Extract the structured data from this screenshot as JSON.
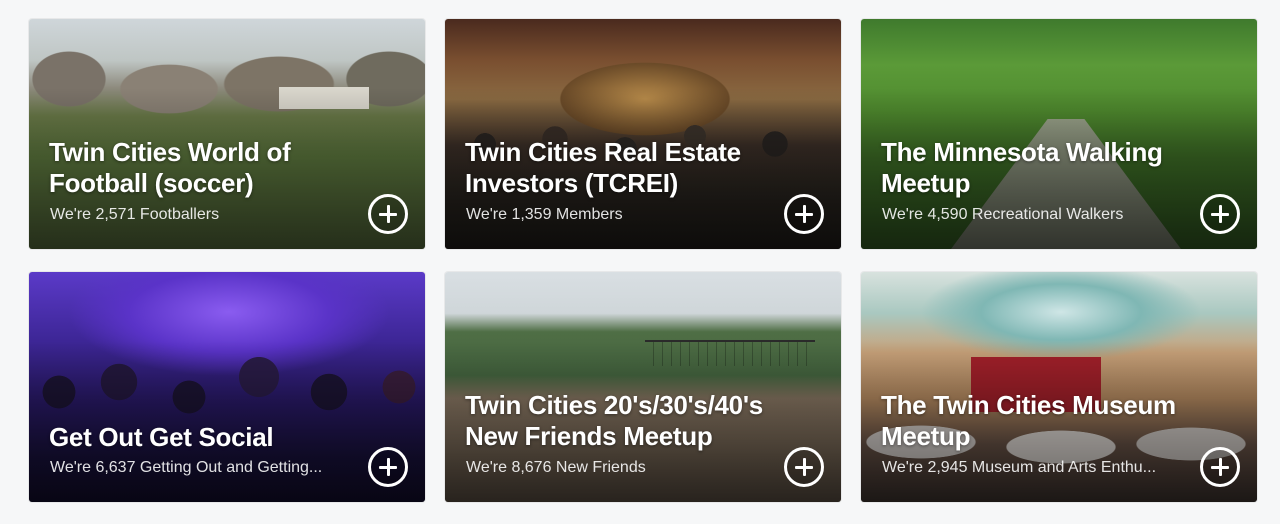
{
  "groups": [
    {
      "title": "Twin Cities World of Football (soccer)",
      "subtitle": "We're 2,571 Footballers"
    },
    {
      "title": "Twin Cities Real Estate Investors (TCREI)",
      "subtitle": "We're 1,359 Members"
    },
    {
      "title": "The Minnesota Walking Meetup",
      "subtitle": "We're 4,590 Recreational Walkers"
    },
    {
      "title": "Get Out Get Social",
      "subtitle": "We're 6,637 Getting Out and Getting..."
    },
    {
      "title": "Twin Cities 20's/30's/40's New Friends Meetup",
      "subtitle": "We're 8,676 New Friends"
    },
    {
      "title": "The Twin Cities Museum Meetup",
      "subtitle": "We're 2,945 Museum and Arts Enthu..."
    }
  ],
  "icons": {
    "join": "plus-circle-icon"
  }
}
